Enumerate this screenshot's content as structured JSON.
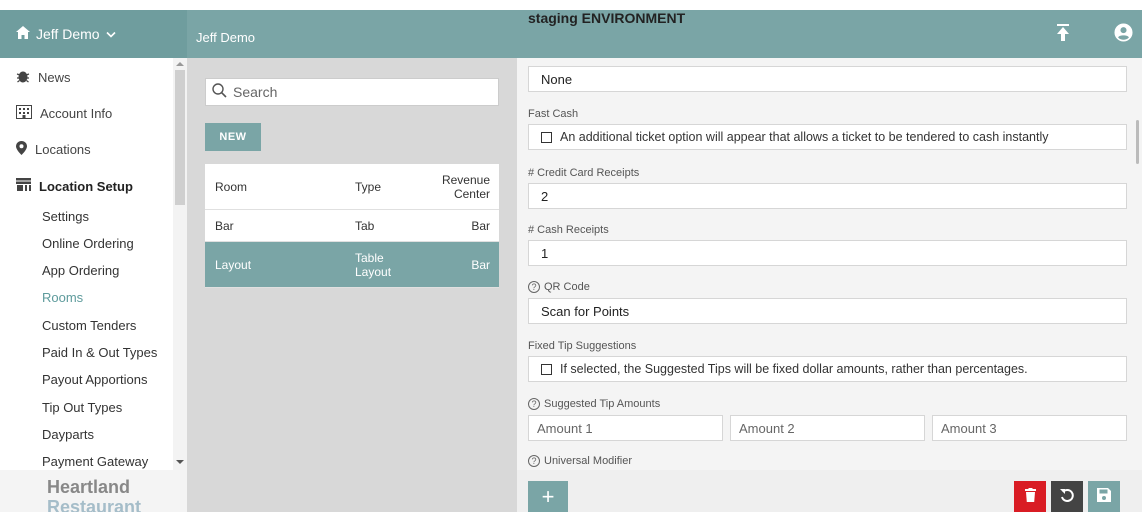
{
  "header": {
    "brand_label": "Jeff Demo",
    "company_name": "Jeff Demo",
    "environment": "staging ENVIRONMENT"
  },
  "sidebar": {
    "items": [
      {
        "label": "News",
        "icon": "bug-icon"
      },
      {
        "label": "Account Info",
        "icon": "building-icon"
      },
      {
        "label": "Locations",
        "icon": "map-marker-icon"
      },
      {
        "label": "Location Setup",
        "icon": "store-icon"
      }
    ],
    "subitems": [
      "Settings",
      "Online Ordering",
      "App Ordering",
      "Rooms",
      "Custom Tenders",
      "Paid In & Out Types",
      "Payout Apportions",
      "Tip Out Types",
      "Dayparts",
      "Payment Gateway"
    ],
    "active_subitem": "Rooms",
    "logo_line1": "Heartland",
    "logo_line2": "Restaurant"
  },
  "list_panel": {
    "search_placeholder": "Search",
    "new_button": "NEW",
    "columns": [
      "Room",
      "Type",
      "Revenue Center"
    ],
    "rows": [
      {
        "room": "Bar",
        "type": "Tab",
        "revenue_center": "Bar"
      },
      {
        "room": "Layout",
        "type": "Table Layout",
        "revenue_center": "Bar"
      }
    ]
  },
  "detail": {
    "top_value": "None",
    "fast_cash": {
      "label": "Fast Cash",
      "text": "An additional ticket option will appear that allows a ticket to be tendered to cash instantly"
    },
    "credit_card_receipts": {
      "label": "# Credit Card Receipts",
      "value": "2"
    },
    "cash_receipts": {
      "label": "# Cash Receipts",
      "value": "1"
    },
    "qr_code": {
      "label": "QR Code",
      "value": "Scan for Points"
    },
    "fixed_tip": {
      "label": "Fixed Tip Suggestions",
      "text": "If selected, the Suggested Tips will be fixed dollar amounts, rather than percentages."
    },
    "suggested_tips": {
      "label": "Suggested Tip Amounts",
      "placeholders": [
        "Amount 1",
        "Amount 2",
        "Amount 3"
      ]
    },
    "universal_modifier": {
      "label": "Universal Modifier"
    }
  },
  "colors": {
    "teal": "#7aa5a6",
    "delete": "#d91c24",
    "dark": "#444444"
  }
}
